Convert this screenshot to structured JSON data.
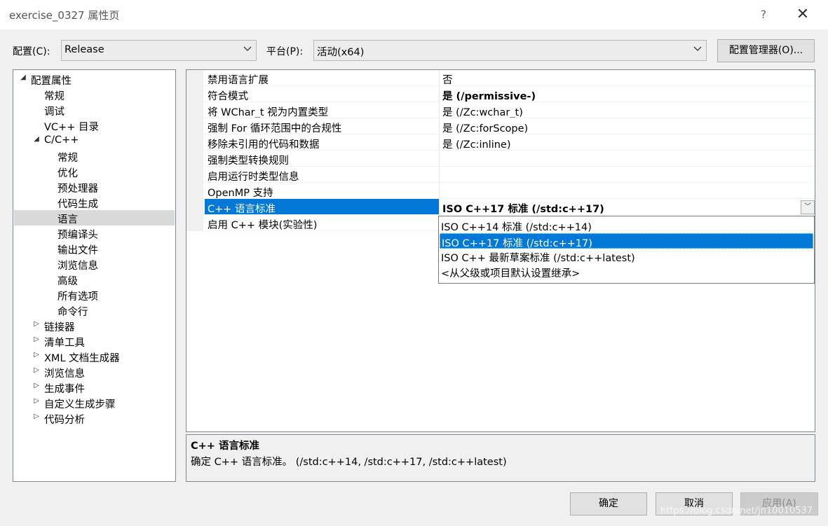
{
  "window": {
    "title": "exercise_0327 属性页",
    "help_glyph": "?",
    "close_glyph": "✕"
  },
  "config": {
    "label": "配置(C):",
    "value": "Release"
  },
  "platform": {
    "label": "平台(P):",
    "value": "活动(x64)"
  },
  "config_manager_button": "配置管理器(O)...",
  "tree": {
    "items": [
      {
        "label": "配置属性",
        "expander": "◢"
      },
      {
        "label": "常规",
        "expander": ""
      },
      {
        "label": "调试",
        "expander": ""
      },
      {
        "label": "VC++ 目录",
        "expander": ""
      },
      {
        "label": "C/C++",
        "expander": "◢"
      },
      {
        "label": "常规",
        "expander": ""
      },
      {
        "label": "优化",
        "expander": ""
      },
      {
        "label": "预处理器",
        "expander": ""
      },
      {
        "label": "代码生成",
        "expander": ""
      },
      {
        "label": "语言",
        "expander": ""
      },
      {
        "label": "预编译头",
        "expander": ""
      },
      {
        "label": "输出文件",
        "expander": ""
      },
      {
        "label": "浏览信息",
        "expander": ""
      },
      {
        "label": "高级",
        "expander": ""
      },
      {
        "label": "所有选项",
        "expander": ""
      },
      {
        "label": "命令行",
        "expander": ""
      },
      {
        "label": "链接器",
        "expander": "▷"
      },
      {
        "label": "清单工具",
        "expander": "▷"
      },
      {
        "label": "XML 文档生成器",
        "expander": "▷"
      },
      {
        "label": "浏览信息",
        "expander": "▷"
      },
      {
        "label": "生成事件",
        "expander": "▷"
      },
      {
        "label": "自定义生成步骤",
        "expander": "▷"
      },
      {
        "label": "代码分析",
        "expander": "▷"
      }
    ],
    "selected": "语言"
  },
  "properties": [
    {
      "name": "禁用语言扩展",
      "value": "否"
    },
    {
      "name": "符合模式",
      "value": "是 (/permissive-)"
    },
    {
      "name": "将 WChar_t 视为内置类型",
      "value": "是 (/Zc:wchar_t)"
    },
    {
      "name": "强制 For 循环范围中的合规性",
      "value": "是 (/Zc:forScope)"
    },
    {
      "name": "移除未引用的代码和数据",
      "value": "是 (/Zc:inline)"
    },
    {
      "name": "强制类型转换规则",
      "value": ""
    },
    {
      "name": "启用运行时类型信息",
      "value": ""
    },
    {
      "name": "OpenMP 支持",
      "value": ""
    },
    {
      "name": "C++ 语言标准",
      "value": "ISO C++17 标准 (/std:c++17)"
    },
    {
      "name": "启用 C++ 模块(实验性)",
      "value": ""
    }
  ],
  "dropdown": {
    "button_glyph": "﹀",
    "options": [
      "ISO C++14 标准 (/std:c++14)",
      "ISO C++17 标准 (/std:c++17)",
      "ISO C++ 最新草案标准 (/std:c++latest)",
      "<从父级或项目默认设置继承>"
    ],
    "selected_index": 1
  },
  "description": {
    "title": "C++ 语言标准",
    "text": "确定 C++ 语言标准。     (/std:c++14, /std:c++17, /std:c++latest)"
  },
  "buttons": {
    "ok": "确定",
    "cancel": "取消",
    "apply": "应用(A)"
  },
  "watermark": "https://blog.csdn.net/jn10010537"
}
